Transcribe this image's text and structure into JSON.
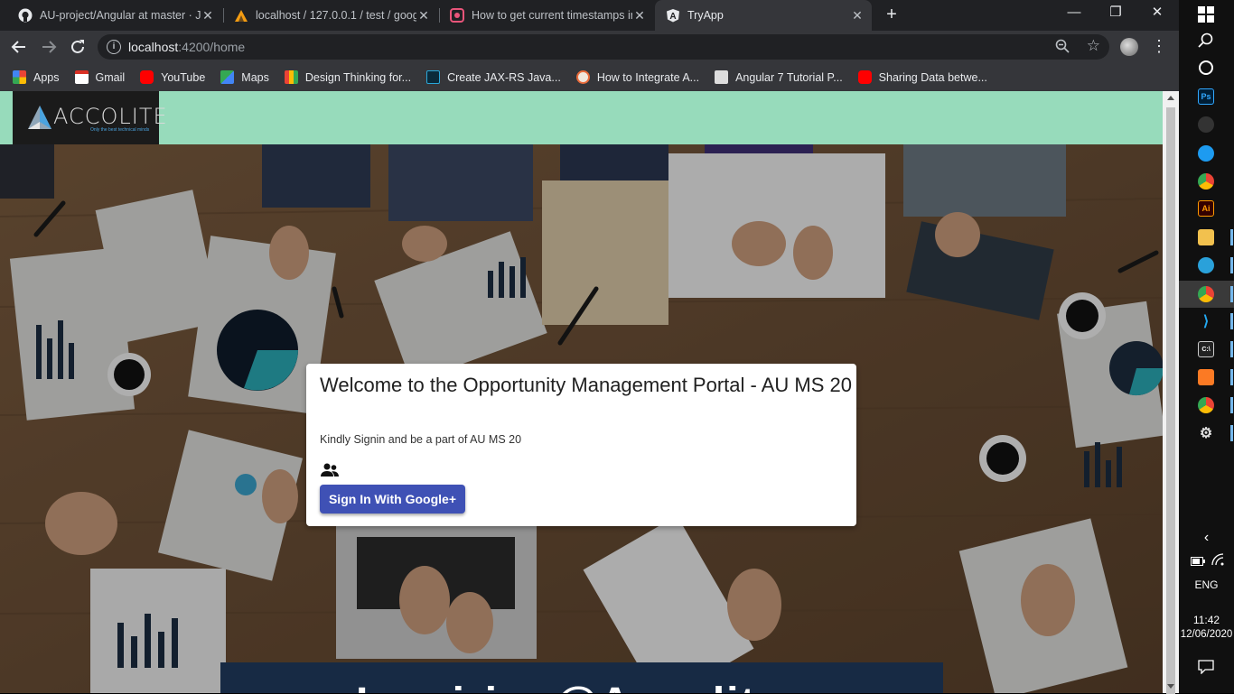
{
  "browser": {
    "tabs": [
      {
        "title": "AU-project/Angular at master · Ja",
        "icon": "github-icon"
      },
      {
        "title": "localhost / 127.0.0.1 / test / goog",
        "icon": "phpmyadmin-icon"
      },
      {
        "title": "How to get current timestamps in",
        "icon": "stackoverflow-icon"
      },
      {
        "title": "TryApp",
        "icon": "angular-icon"
      }
    ],
    "url_host": "localhost",
    "url_rest": ":4200/home",
    "bookmarks": [
      {
        "label": "Apps",
        "icon": "apps-grid-icon",
        "color": "#e74c3c"
      },
      {
        "label": "Gmail",
        "icon": "gmail-icon",
        "color": "#d93025"
      },
      {
        "label": "YouTube",
        "icon": "youtube-icon",
        "color": "#ff0000"
      },
      {
        "label": "Maps",
        "icon": "maps-icon",
        "color": "#34a853"
      },
      {
        "label": "Design Thinking for...",
        "icon": "slides-icon",
        "color": "#f4b400"
      },
      {
        "label": "Create JAX-RS Java...",
        "icon": "px-icon",
        "color": "#0a6aa1"
      },
      {
        "label": "How to Integrate A...",
        "icon": "site-icon",
        "color": "#e96b3b"
      },
      {
        "label": "Angular 7 Tutorial P...",
        "icon": "avatar-icon",
        "color": "#aaaaaa"
      },
      {
        "label": "Sharing Data betwe...",
        "icon": "youtube-icon",
        "color": "#ff0000"
      }
    ]
  },
  "header": {
    "logo_text": "ACCOLITE",
    "logo_tagline": "Only the best technical minds"
  },
  "card": {
    "title": "Welcome to the Opportunity Management Portal - AU MS 20",
    "subtitle": "Kindly Signin and be a part of AU MS 20",
    "signin_label": "Sign In With Google+"
  },
  "banner": {
    "text": "Inspiring@Accolite"
  },
  "taskbar": {
    "language": "ENG",
    "time": "11:42",
    "date": "12/06/2020"
  },
  "colors": {
    "header_bg": "#97dbbb",
    "button_bg": "#3f51b5",
    "banner_bg": "#172a44"
  }
}
